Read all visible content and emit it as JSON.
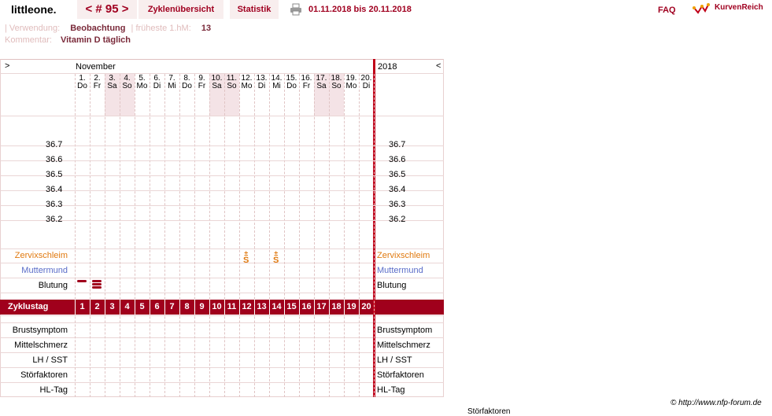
{
  "header": {
    "brand": "littleone.",
    "cycle_tab": "< # 95 >",
    "overview_tab": "Zyklenübersicht",
    "stats_tab": "Statistik",
    "date_range": "01.11.2018 bis 20.11.2018",
    "faq": "FAQ",
    "logo": "KurvenReich"
  },
  "info": {
    "usage_label": "| Verwendung:",
    "usage_value": "Beobachtung",
    "earliest_label": "| früheste 1.hM:",
    "earliest_value": "13",
    "comment_label": "Kommentar:",
    "comment_value": "Vitamin D täglich"
  },
  "chart": {
    "nav_left": ">",
    "nav_right": "<",
    "month": "November",
    "year": "2018",
    "days": [
      {
        "n": "1.",
        "d": "Do"
      },
      {
        "n": "2.",
        "d": "Fr"
      },
      {
        "n": "3.",
        "d": "Sa"
      },
      {
        "n": "4.",
        "d": "So"
      },
      {
        "n": "5.",
        "d": "Mo"
      },
      {
        "n": "6.",
        "d": "Di"
      },
      {
        "n": "7.",
        "d": "Mi"
      },
      {
        "n": "8.",
        "d": "Do"
      },
      {
        "n": "9.",
        "d": "Fr"
      },
      {
        "n": "10.",
        "d": "Sa"
      },
      {
        "n": "11.",
        "d": "So"
      },
      {
        "n": "12.",
        "d": "Mo"
      },
      {
        "n": "13.",
        "d": "Di"
      },
      {
        "n": "14.",
        "d": "Mi"
      },
      {
        "n": "15.",
        "d": "Do"
      },
      {
        "n": "16.",
        "d": "Fr"
      },
      {
        "n": "17.",
        "d": "Sa"
      },
      {
        "n": "18.",
        "d": "So"
      },
      {
        "n": "19.",
        "d": "Mo"
      },
      {
        "n": "20.",
        "d": "Di"
      }
    ],
    "weekend_days": [
      3,
      4,
      10,
      11,
      17,
      18
    ],
    "temperatures": [
      "36.7",
      "36.6",
      "36.5",
      "36.4",
      "36.3",
      "36.2"
    ],
    "rows": {
      "cervix": "Zervixschleim",
      "cervix_symbol": "S̶",
      "cervix_days": [
        12,
        14
      ],
      "os": "Muttermund",
      "bleeding": "Blutung",
      "bleeding_levels": [
        {
          "day": 1,
          "level": 1
        },
        {
          "day": 2,
          "level": 3
        }
      ],
      "cycle_day": "Zyklustag",
      "cycle_numbers": [
        "1",
        "2",
        "3",
        "4",
        "5",
        "6",
        "7",
        "8",
        "9",
        "10",
        "11",
        "12",
        "13",
        "14",
        "15",
        "16",
        "17",
        "18",
        "19",
        "20"
      ],
      "breast": "Brustsymptom",
      "midpain": "Mittelschmerz",
      "lh": "LH / SST",
      "disturb": "Störfaktoren",
      "hl": "HL-Tag"
    }
  },
  "footer": {
    "copyright": "© http://www.nfp-forum.de",
    "bottom_label": "Störfaktoren"
  },
  "colors": {
    "accent": "#a0001c",
    "cervix": "#e07a10",
    "os": "#5a6cc8"
  }
}
